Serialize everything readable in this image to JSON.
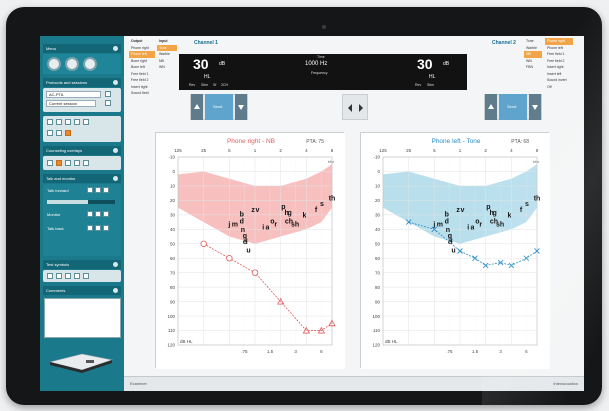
{
  "left_panel": {
    "menu_title": "Menu",
    "protocols_title": "Protocols and sessions",
    "protocol_value": "AC-PTA",
    "current_session": "Current session",
    "counseling_title": "Counseling overlays",
    "talk_title": "Talk and monitor",
    "talk_forward": "Talk forward",
    "monitor_label": "Monitor",
    "talk_back": "Talk back",
    "test_symbols_title": "Test symbols",
    "comments_title": "Comments"
  },
  "channel1": {
    "label": "Channel 1",
    "output_header": "Output",
    "input_header": "Input",
    "outputs": [
      "Phone right",
      "Phone left",
      "Bone right",
      "Bone left",
      "Free field 1",
      "Free field 2",
      "Insert right",
      "Sound field"
    ],
    "inputs": [
      "Tone",
      "Warble",
      "NB",
      "WN"
    ],
    "active_output": "Phone left",
    "active_input": "Tone",
    "level": "30",
    "level_unit": "dB",
    "level_scale": "HL",
    "flags": [
      "Rev",
      "Stim",
      "Sf",
      "2CH"
    ],
    "send_label": "Send"
  },
  "center": {
    "time_label": "Time",
    "frequency_value": "1000 Hz",
    "frequency_label": "Frequency"
  },
  "channel2": {
    "label": "Channel 2",
    "inputs": [
      "Tone",
      "Warble",
      "NB",
      "WN",
      "FBN"
    ],
    "outputs": [
      "Phone right",
      "Phone left",
      "Free field 1",
      "Free field 2",
      "Insert right",
      "Insert left",
      "Sound invert",
      "Off"
    ],
    "active_input": "NB",
    "active_output": "Phone right",
    "level": "30",
    "level_unit": "dB",
    "level_scale": "HL",
    "flags": [
      "Rev",
      "Stim"
    ],
    "send_label": "Send"
  },
  "audiogram_left": {
    "title": "Phone right - NB",
    "pta_label": "PTA:",
    "pta_value": "75",
    "freq_top": [
      "125",
      "25",
      "5",
      "1",
      "2",
      "4",
      "8"
    ],
    "freq_bottom": [
      ".75",
      "1.5",
      "3",
      "6"
    ],
    "khz_label": "kHz",
    "db_ticks": [
      "-10",
      "0",
      "10",
      "20",
      "30",
      "40",
      "50",
      "60",
      "70",
      "80",
      "90",
      "100",
      "110",
      "120"
    ],
    "db_label": "dB HL",
    "markers": [
      {
        "f": "250",
        "db": "50"
      },
      {
        "f": "500",
        "db": "60"
      },
      {
        "f": "1000",
        "db": "70"
      },
      {
        "f": "2000",
        "db": "90"
      },
      {
        "f": "4000",
        "db": "110"
      },
      {
        "f": "6000",
        "db": "110"
      },
      {
        "f": "8000",
        "db": "105"
      }
    ]
  },
  "audiogram_right": {
    "title": "Phone left - Tone",
    "pta_label": "PTA:",
    "pta_value": "68",
    "freq_top": [
      "125",
      "25",
      "5",
      "1",
      "2",
      "4",
      "8"
    ],
    "freq_bottom": [
      ".75",
      "1.5",
      "3",
      "6"
    ],
    "khz_label": "kHz",
    "db_ticks": [
      "-10",
      "0",
      "10",
      "20",
      "30",
      "40",
      "50",
      "60",
      "70",
      "80",
      "90",
      "100",
      "110",
      "120"
    ],
    "db_label": "dB HL",
    "markers": [
      {
        "f": "250",
        "db": "35"
      },
      {
        "f": "500",
        "db": "40"
      },
      {
        "f": "1000",
        "db": "55"
      },
      {
        "f": "1500",
        "db": "60"
      },
      {
        "f": "2000",
        "db": "65"
      },
      {
        "f": "3000",
        "db": "63"
      },
      {
        "f": "4000",
        "db": "65"
      },
      {
        "f": "6000",
        "db": "60"
      },
      {
        "f": "8000",
        "db": "55"
      }
    ]
  },
  "speech_sounds": [
    "z",
    "v",
    "j",
    "m",
    "d",
    "b",
    "n",
    "g",
    "e",
    "l",
    "u",
    "i",
    "a",
    "o",
    "r",
    "p",
    "h",
    "g",
    "ch",
    "sh",
    "k",
    "f",
    "s",
    "th"
  ],
  "status_bar": {
    "left": "Examiner",
    "right": "Interacoustics"
  },
  "colors": {
    "device": "#151617",
    "sidebar": "#1a7a8c",
    "right_ear": "#e25c5c",
    "left_ear": "#2d8fc4",
    "orange_selected": "#f2a447",
    "display": "#121212"
  }
}
